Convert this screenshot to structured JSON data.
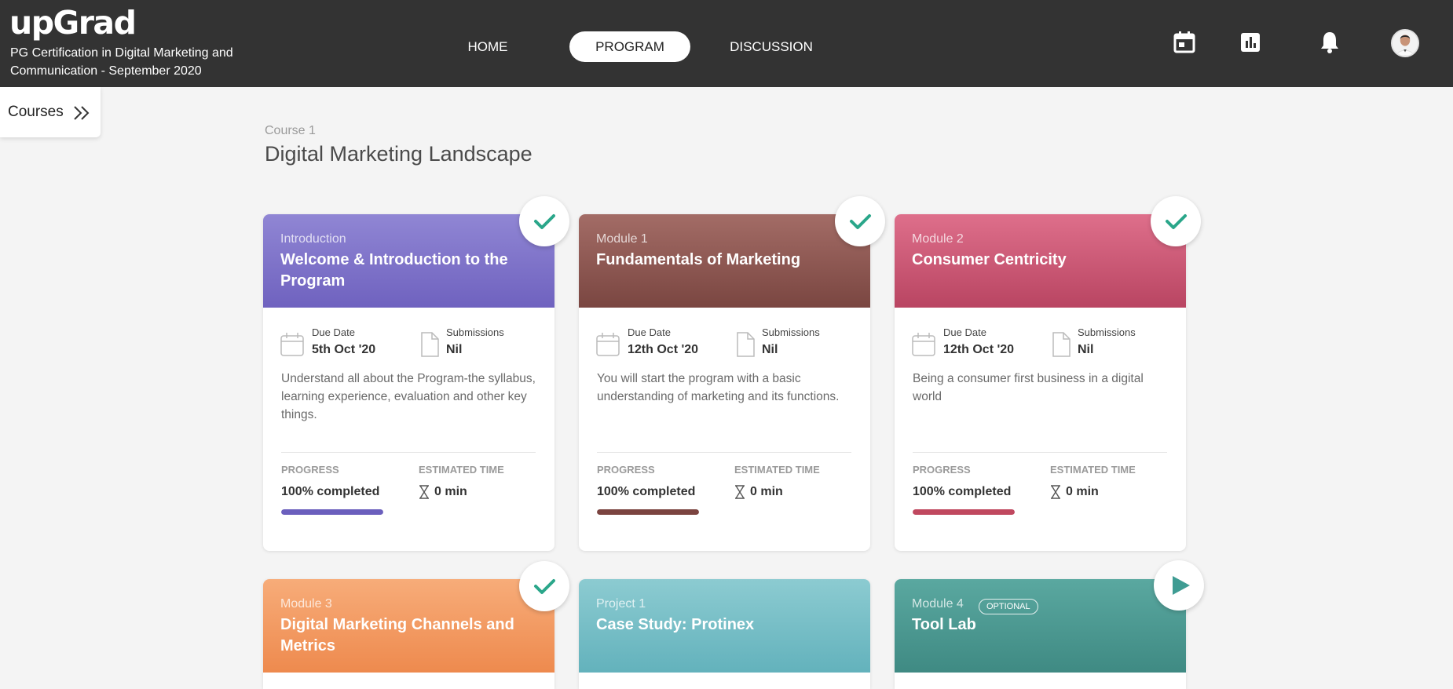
{
  "header": {
    "logo": "upGrad",
    "program_name": "PG Certification in Digital Marketing and Communication - September 2020",
    "nav": [
      "HOME",
      "PROGRAM",
      "DISCUSSION"
    ],
    "active_nav": "PROGRAM",
    "icons": [
      "calendar-icon",
      "bar-chart-icon",
      "bell-icon",
      "user-avatar"
    ]
  },
  "sidebar": {
    "courses_label": "Courses"
  },
  "course": {
    "number": "Course 1",
    "title": "Digital Marketing Landscape"
  },
  "labels": {
    "due_date": "Due Date",
    "submissions": "Submissions",
    "progress": "PROGRESS",
    "estimated_time": "ESTIMATED TIME"
  },
  "cards": [
    {
      "kicker": "Introduction",
      "title": "Welcome & Introduction to the Program",
      "due_date": "5th Oct '20",
      "submissions": "Nil",
      "description": "Understand all about the Program-the syllabus, learning experience, evaluation and other key things.",
      "progress_text": "100% completed",
      "progress": 1.0,
      "estimated_time": "0 min",
      "status": "completed",
      "color_top": "#9086d4",
      "color_bottom": "#6f62bf",
      "accent": "#6b5fbd"
    },
    {
      "kicker": "Module 1",
      "title": "Fundamentals of Marketing",
      "due_date": "12th Oct '20",
      "submissions": "Nil",
      "description": "You will start the program with a basic understanding of marketing and its functions.",
      "progress_text": "100% completed",
      "progress": 1.0,
      "estimated_time": "0 min",
      "status": "completed",
      "color_top": "#a36c66",
      "color_bottom": "#7a4641",
      "accent": "#7b4440"
    },
    {
      "kicker": "Module 2",
      "title": "Consumer Centricity",
      "due_date": "12th Oct '20",
      "submissions": "Nil",
      "description": "Being a consumer first business in a digital world",
      "progress_text": "100% completed",
      "progress": 1.0,
      "estimated_time": "0 min",
      "status": "completed",
      "color_top": "#de6f8b",
      "color_bottom": "#b94562",
      "accent": "#c0485f"
    },
    {
      "kicker": "Module 3",
      "title": "Digital Marketing Channels and Metrics",
      "status": "completed",
      "color_top": "#f7ac79",
      "color_bottom": "#ee8a4e",
      "accent": "#ee8a4e"
    },
    {
      "kicker": "Project 1",
      "title": "Case Study: Protinex",
      "status": "none",
      "color_top": "#8ccbd1",
      "color_bottom": "#63b2bc",
      "accent": "#63b2bc"
    },
    {
      "kicker": "Module 4",
      "title": "Tool Lab",
      "badge": "OPTIONAL",
      "status": "play",
      "color_top": "#5aa8a0",
      "color_bottom": "#3f8a83",
      "accent": "#3f9c93"
    }
  ],
  "colors": {
    "check": "#2aa68a",
    "header_bg": "#333333"
  }
}
